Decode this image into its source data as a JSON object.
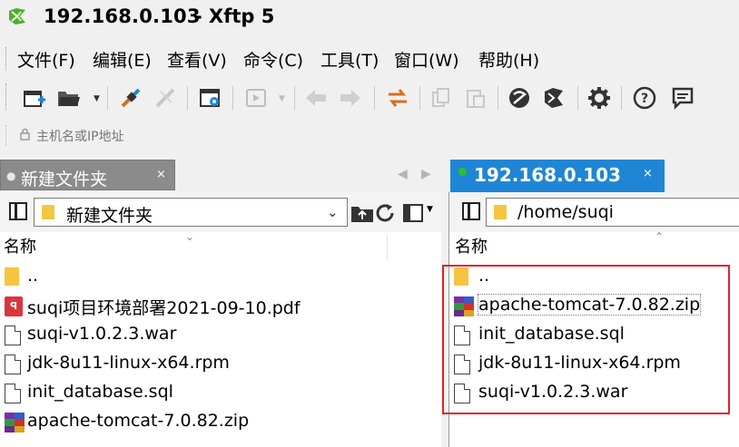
{
  "window": {
    "host": "192.168.0.103",
    "app_name": "- Xftp 5"
  },
  "menu": {
    "items": [
      "文件(F)",
      "编辑(E)",
      "查看(V)",
      "命令(C)",
      "工具(T)",
      "窗口(W)",
      "帮助(H)"
    ]
  },
  "toolbar": {
    "icons": [
      "new-session-icon",
      "open-folder-icon",
      "connect-icon",
      "disconnect-icon",
      "properties-icon",
      "play-icon",
      "back-arrow-icon",
      "forward-arrow-icon",
      "transfer-icon",
      "copy-icon",
      "paste-icon",
      "xshell-icon",
      "xftp-icon",
      "gear-icon",
      "help-icon",
      "chat-icon"
    ]
  },
  "address": {
    "placeholder": "主机名或IP地址"
  },
  "left_tab": {
    "label": "新建文件夹",
    "close": "×"
  },
  "right_tab": {
    "label": "192.168.0.103",
    "close": "×",
    "status_color": "#2ac02a",
    "accent": "#1f86d6"
  },
  "left_pane": {
    "path": "新建文件夹",
    "column_name": "名称",
    "files": [
      {
        "name": "..",
        "type": "folder"
      },
      {
        "name": "suqi项目环境部署2021-09-10.pdf",
        "type": "pdf"
      },
      {
        "name": "suqi-v1.0.2.3.war",
        "type": "file"
      },
      {
        "name": "jdk-8u11-linux-x64.rpm",
        "type": "file"
      },
      {
        "name": "init_database.sql",
        "type": "file"
      },
      {
        "name": "apache-tomcat-7.0.82.zip",
        "type": "zip"
      }
    ]
  },
  "right_pane": {
    "path": "/home/suqi",
    "column_name": "名称",
    "files": [
      {
        "name": "..",
        "type": "folder"
      },
      {
        "name": "apache-tomcat-7.0.82.zip",
        "type": "zip",
        "selected": true
      },
      {
        "name": "init_database.sql",
        "type": "file"
      },
      {
        "name": "jdk-8u11-linux-x64.rpm",
        "type": "file"
      },
      {
        "name": "suqi-v1.0.2.3.war",
        "type": "file"
      }
    ]
  },
  "highlight_color": "#e2222a"
}
